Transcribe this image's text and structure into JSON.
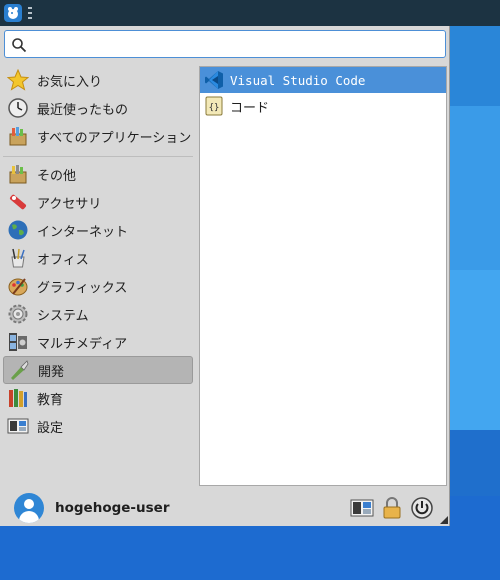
{
  "search": {
    "placeholder": ""
  },
  "categories": [
    {
      "label": "お気に入り",
      "icon": "star-icon"
    },
    {
      "label": "最近使ったもの",
      "icon": "clock-icon"
    },
    {
      "label": "すべてのアプリケーション",
      "icon": "all-apps-icon"
    },
    {
      "label": "その他",
      "icon": "other-icon"
    },
    {
      "label": "アクセサリ",
      "icon": "accessories-icon"
    },
    {
      "label": "インターネット",
      "icon": "globe-icon"
    },
    {
      "label": "オフィス",
      "icon": "office-icon"
    },
    {
      "label": "グラフィックス",
      "icon": "palette-icon"
    },
    {
      "label": "システム",
      "icon": "gear-icon"
    },
    {
      "label": "マルチメディア",
      "icon": "multimedia-icon"
    },
    {
      "label": "開発",
      "icon": "development-icon"
    },
    {
      "label": "教育",
      "icon": "education-icon"
    },
    {
      "label": "設定",
      "icon": "settings-icon"
    }
  ],
  "selected_category": "開発",
  "apps": [
    {
      "label": "Visual Studio Code",
      "icon": "vscode-icon",
      "active": true
    },
    {
      "label": "コード",
      "icon": "code-file-icon",
      "active": false
    }
  ],
  "user": {
    "name": "hogehoge-user"
  },
  "colors": {
    "panel": "#1c3342",
    "selection": "#4a90d9",
    "menu_bg": "#d8d8d8",
    "desktop": "#2f7fd3"
  }
}
